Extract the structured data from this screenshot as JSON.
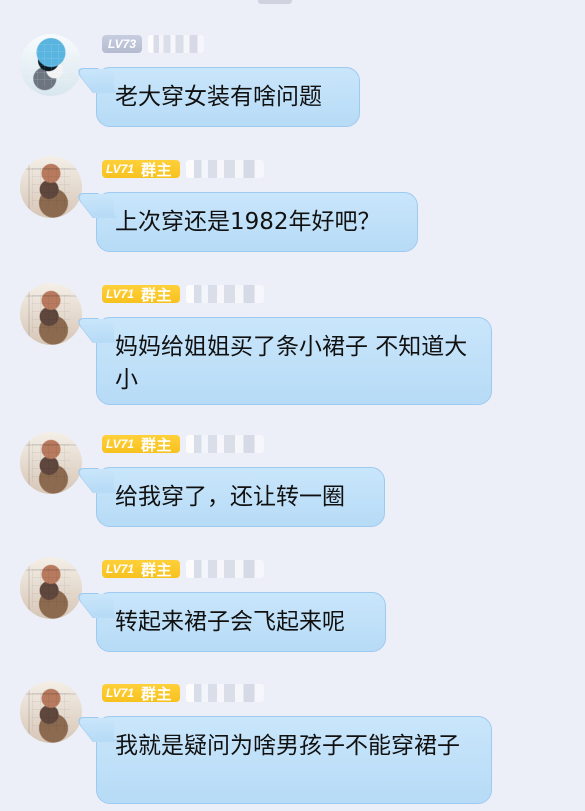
{
  "chat": {
    "messages": [
      {
        "avatar": "user-avatar",
        "level": "LV73",
        "role": "",
        "text": "老大穿女装有啥问题"
      },
      {
        "avatar": "owner-avatar",
        "level": "LV71",
        "role": "群主",
        "text": "上次穿还是1982年好吧？"
      },
      {
        "avatar": "owner-avatar",
        "level": "LV71",
        "role": "群主",
        "text": "妈妈给姐姐买了条小裙子 不知道大小"
      },
      {
        "avatar": "owner-avatar",
        "level": "LV71",
        "role": "群主",
        "text": "给我穿了，还让转一圈"
      },
      {
        "avatar": "owner-avatar",
        "level": "LV71",
        "role": "群主",
        "text": "转起来裙子会飞起来呢"
      },
      {
        "avatar": "owner-avatar",
        "level": "LV71",
        "role": "群主",
        "text": "我就是疑问为啥男孩子不能穿裙子"
      }
    ]
  }
}
